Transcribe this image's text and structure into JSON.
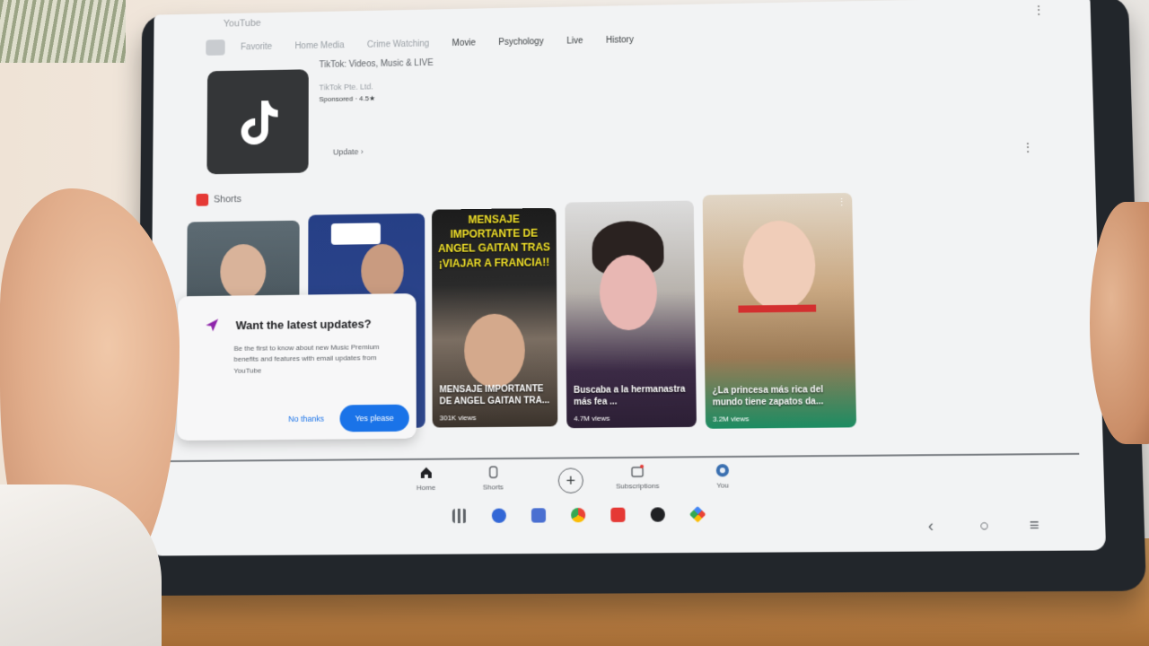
{
  "topbar": {
    "app_name": "YouTube",
    "chips": [
      "Favorite",
      "Home Media",
      "Crime Watching",
      "Movie",
      "Psychology",
      "Live",
      "History"
    ]
  },
  "app_card": {
    "title": "TikTok: Videos, Music & LIVE",
    "subtitle": "TikTok Pte. Ltd.",
    "meta": "Sponsored · 4.5★",
    "update_label": "Update"
  },
  "shorts": {
    "label": "Shorts",
    "items": [
      {
        "caption": "",
        "views": ""
      },
      {
        "caption": "",
        "views": ""
      },
      {
        "banner": "MENSAJE IMPORTANTE DE ANGEL GAITAN TRAS ¡VIAJAR A FRANCIA!!",
        "caption": "MENSAJE IMPORTANTE DE ANGEL GAITAN TRA...",
        "views": "301K views"
      },
      {
        "caption": "Buscaba a la hermanastra más fea ...",
        "views": "4.7M views"
      },
      {
        "caption": "¿La princesa más rica del mundo tiene zapatos da...",
        "views": "3.2M views"
      }
    ]
  },
  "popup": {
    "title": "Want the latest updates?",
    "body": "Be the first to know about new Music Premium benefits and features with email updates from YouTube",
    "no_label": "No thanks",
    "yes_label": "Yes please"
  },
  "bottom_nav": [
    {
      "label": "Home",
      "icon": "home-icon"
    },
    {
      "label": "Shorts",
      "icon": "shorts-icon"
    },
    {
      "label": "",
      "icon": "add-icon"
    },
    {
      "label": "Subscriptions",
      "icon": "subscriptions-icon"
    },
    {
      "label": "You",
      "icon": "avatar-icon"
    }
  ],
  "colors": {
    "accent": "#1a73e8",
    "shorts_red": "#e53935",
    "screen_bg": "#f2f3f4"
  }
}
